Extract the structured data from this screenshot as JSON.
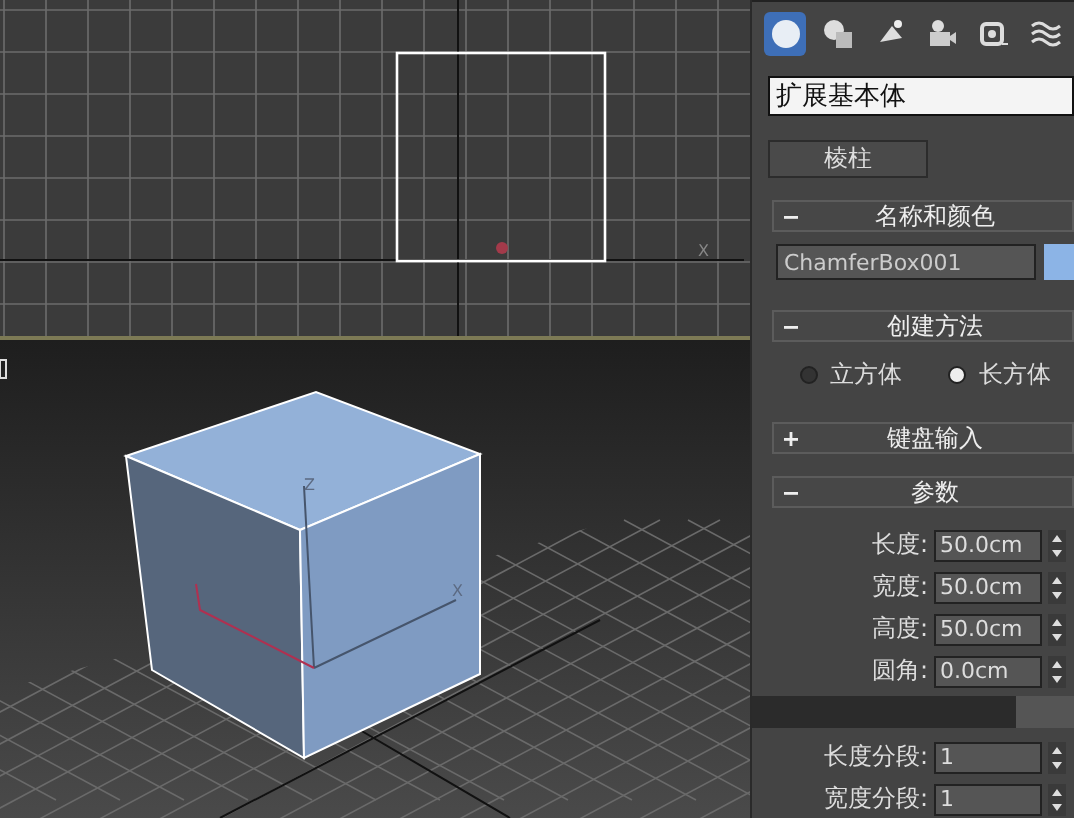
{
  "viewports": [
    {
      "kind": "top",
      "axis_labels": [
        "X"
      ]
    },
    {
      "kind": "perspective",
      "axis_labels": [
        "Z",
        "X"
      ]
    }
  ],
  "command_panel": {
    "categories": [
      {
        "kind": "geometry",
        "selected": true
      },
      {
        "kind": "shapes",
        "selected": false
      },
      {
        "kind": "lights",
        "selected": false
      },
      {
        "kind": "cameras",
        "selected": false
      },
      {
        "kind": "helpers",
        "selected": false
      },
      {
        "kind": "spacewarps",
        "selected": false
      }
    ],
    "dropdown": {
      "value": "扩展基本体"
    },
    "object_buttons": [
      "棱柱"
    ],
    "rollouts": [
      {
        "kind": "name",
        "title": "名称和颜色",
        "expanded": true,
        "name": "ChamferBox001",
        "color": "#8cb4e6"
      },
      {
        "kind": "radios",
        "title": "创建方法",
        "expanded": true,
        "options": [
          {
            "label": "立方体",
            "selected": false
          },
          {
            "label": "长方体",
            "selected": true
          }
        ]
      },
      {
        "title": "键盘输入",
        "expanded": false
      },
      {
        "kind": "params",
        "title": "参数",
        "expanded": true,
        "fields": [
          {
            "kind": "spinner",
            "label": "长度:",
            "value": "50.0cm"
          },
          {
            "kind": "spinner",
            "label": "宽度:",
            "value": "50.0cm"
          },
          {
            "kind": "spinner",
            "label": "高度:",
            "value": "50.0cm"
          },
          {
            "kind": "spinner",
            "label": "圆角:",
            "value": "0.0cm"
          },
          {
            "kind": "slider",
            "level": 0.83
          },
          {
            "kind": "spinner",
            "label": "长度分段:",
            "value": "1"
          },
          {
            "kind": "spinner",
            "label": "宽度分段:",
            "value": "1"
          }
        ]
      }
    ]
  }
}
